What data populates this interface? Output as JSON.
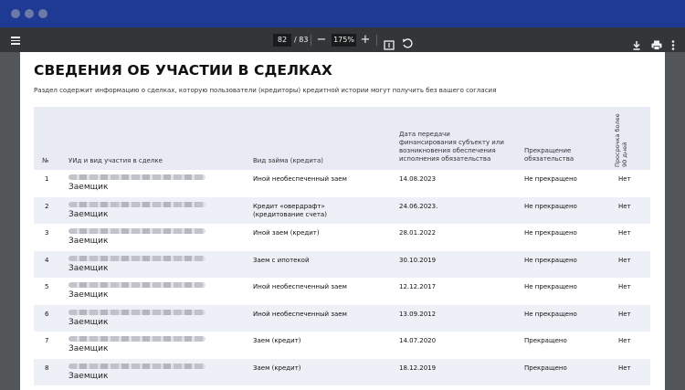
{
  "toolbar": {
    "page_current": "82",
    "page_total": "/ 83",
    "zoom": "175%",
    "zoom_out": "−",
    "zoom_in": "+"
  },
  "document": {
    "title": "СВЕДЕНИЯ ОБ УЧАСТИИ В СДЕЛКАХ",
    "subtitle": "Раздел содержит информацию о сделках, которую пользователи (кредиторы) кредитной истории могут получить без вашего согласия"
  },
  "table": {
    "headers": {
      "num": "№",
      "uid": "УИд и вид участия в сделке",
      "loan_type": "Вид займа (кредита)",
      "date": "Дата передачи финансирования субъекту или возникновения обеспечения исполнения обязательства",
      "termination": "Прекращение обязательства",
      "overdue": "Просрочка более 90 дней"
    },
    "rows": [
      {
        "num": "1",
        "role": "Заемщик",
        "loan_type": "Иной необеспеченный заем",
        "date": "14.08.2023",
        "termination": "Не прекращено",
        "overdue": "Нет"
      },
      {
        "num": "2",
        "role": "Заемщик",
        "loan_type": "Кредит «овердрафт» (кредитование счета)",
        "date": "24.06.2023.",
        "termination": "Не прекращено",
        "overdue": "Нет"
      },
      {
        "num": "3",
        "role": "Заемщик",
        "loan_type": "Иной заем (кредит)",
        "date": "28.01.2022",
        "termination": "Не прекращено",
        "overdue": "Нет"
      },
      {
        "num": "4",
        "role": "Заемщик",
        "loan_type": "Заем с ипотекой",
        "date": "30.10.2019",
        "termination": "Не прекращено",
        "overdue": "Нет"
      },
      {
        "num": "5",
        "role": "Заемщик",
        "loan_type": "Иной необеспеченный заем",
        "date": "12.12.2017",
        "termination": "Не прекращено",
        "overdue": "Нет"
      },
      {
        "num": "6",
        "role": "Заемщик",
        "loan_type": "Иной необеспеченный заем",
        "date": "13.09.2012",
        "termination": "Не прекращено",
        "overdue": "Нет"
      },
      {
        "num": "7",
        "role": "Заемщик",
        "loan_type": "Заем (кредит)",
        "date": "14.07.2020",
        "termination": "Прекращено",
        "overdue": "Нет"
      },
      {
        "num": "8",
        "role": "Заемщик",
        "loan_type": "Заем (кредит)",
        "date": "18.12.2019",
        "termination": "Прекращено",
        "overdue": "Нет"
      }
    ]
  }
}
